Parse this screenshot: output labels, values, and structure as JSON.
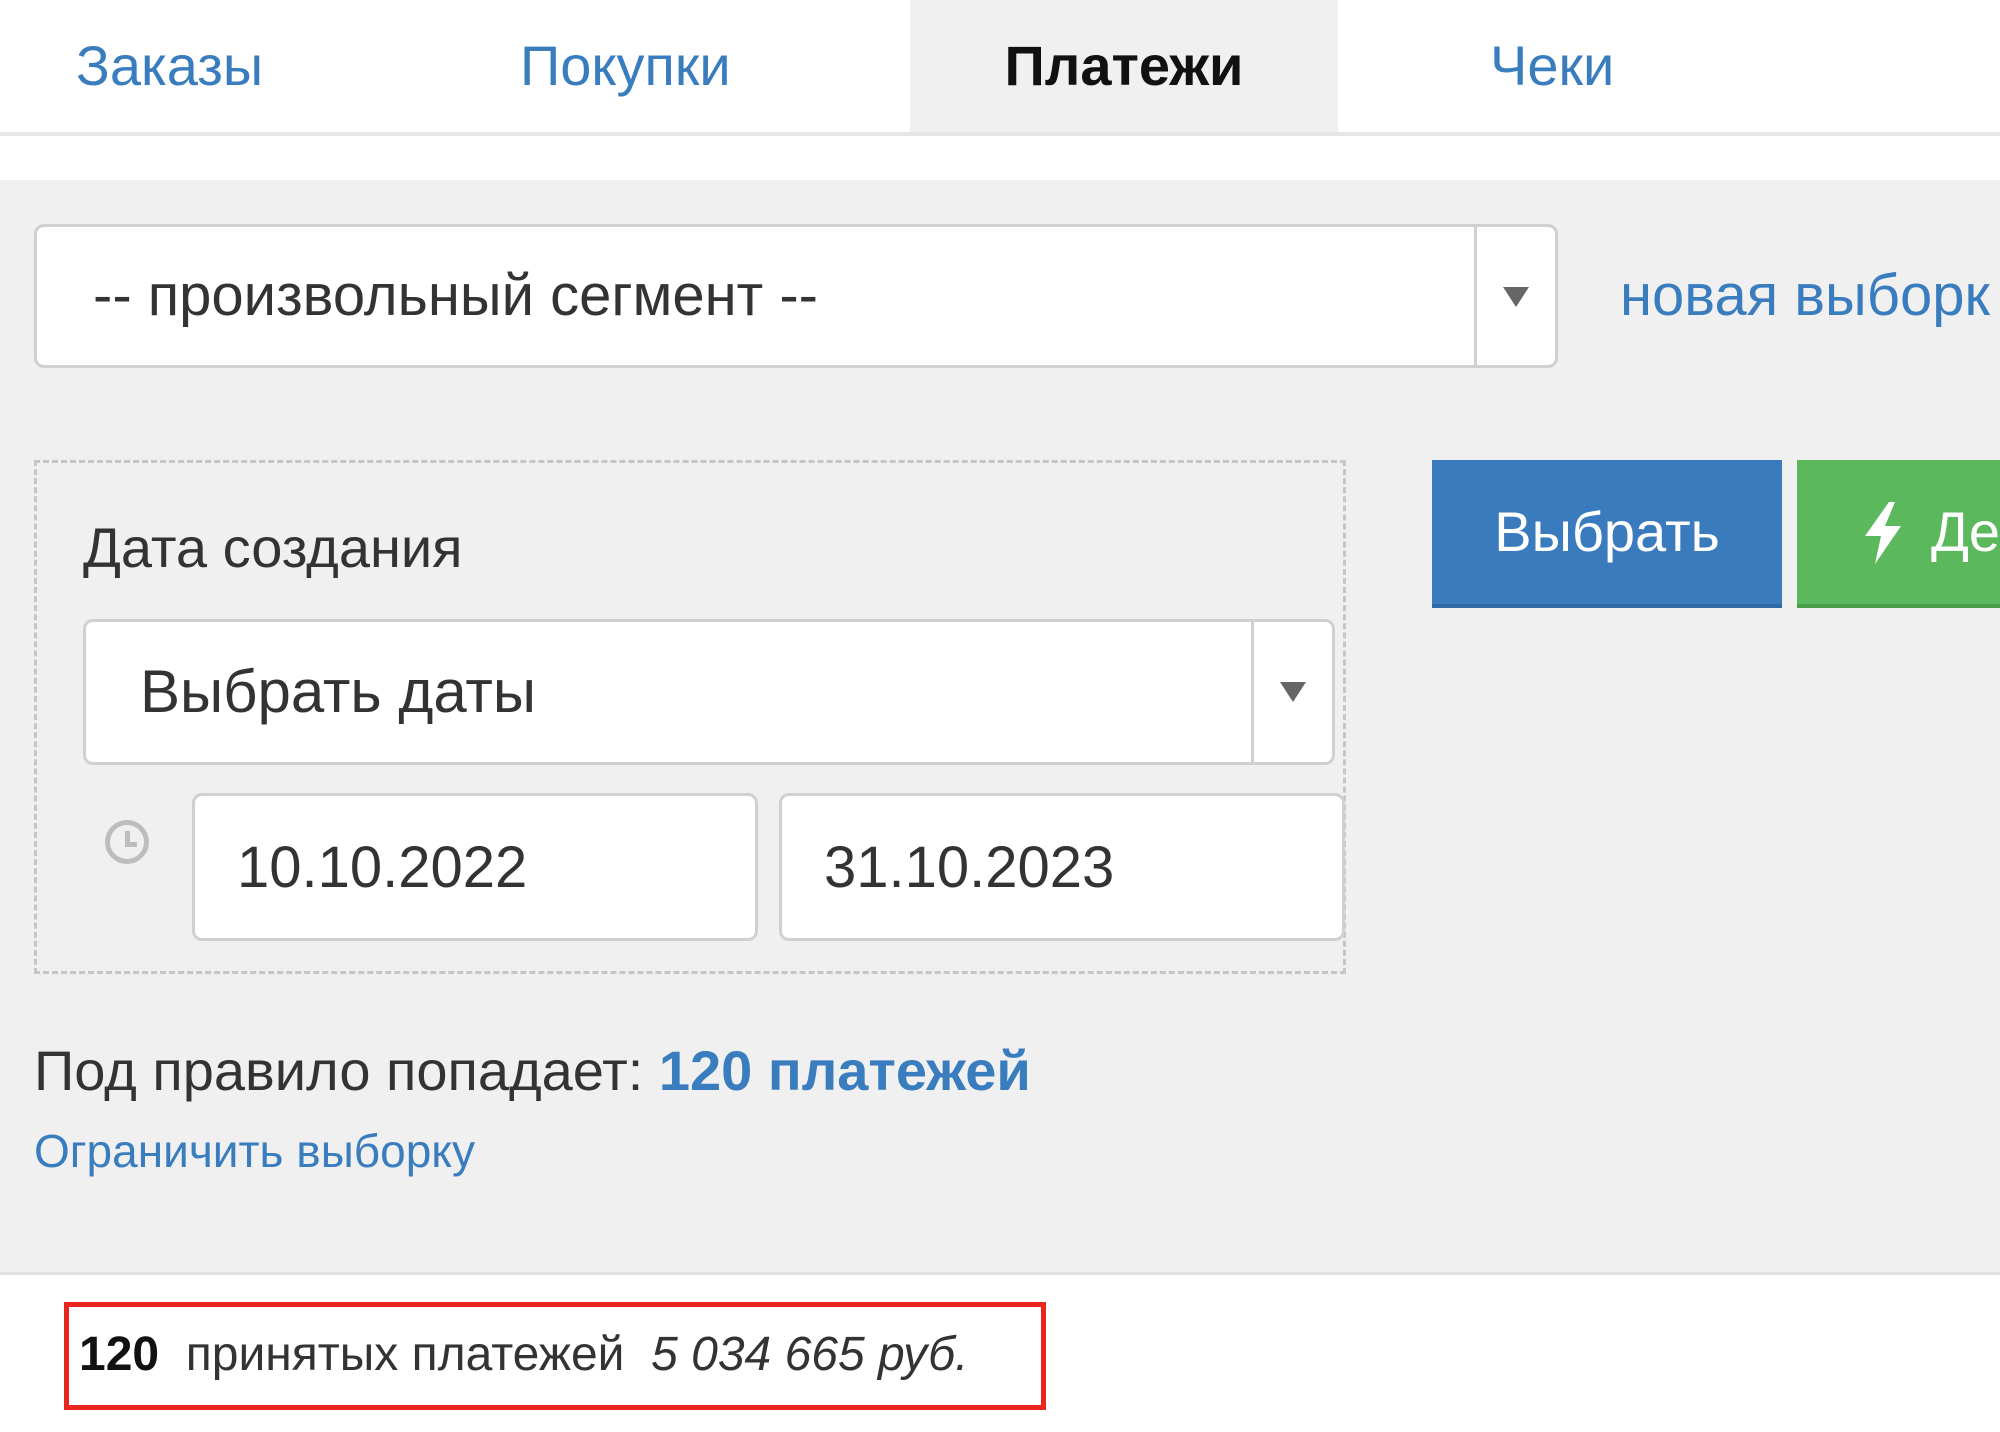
{
  "tabs": [
    {
      "label": "Заказы",
      "active": false
    },
    {
      "label": "Покупки",
      "active": false
    },
    {
      "label": "Платежи",
      "active": true
    },
    {
      "label": "Чеки",
      "active": false
    }
  ],
  "segment": {
    "selected": "-- произвольный сегмент --",
    "new_selection_link": "новая выборк"
  },
  "filter": {
    "label": "Дата создания",
    "date_mode": "Выбрать даты",
    "date_from": "10.10.2022",
    "date_to": "31.10.2023",
    "clock_icon": "clock-icon"
  },
  "buttons": {
    "select": "Выбрать",
    "green": "Де",
    "green_icon": "lightning-icon"
  },
  "rule": {
    "prefix": "Под правило попадает:",
    "count_link": "120 платежей"
  },
  "limit_link": "Ограничить выборку",
  "summary": {
    "count": "120",
    "text": "принятых платежей",
    "amount": "5 034 665 руб."
  },
  "colors": {
    "link": "#3a7dbf",
    "primary_button": "#3a7bbd",
    "success_button": "#5cb85c",
    "highlight_border": "#e8261d",
    "panel_background": "#f0f0f0"
  }
}
